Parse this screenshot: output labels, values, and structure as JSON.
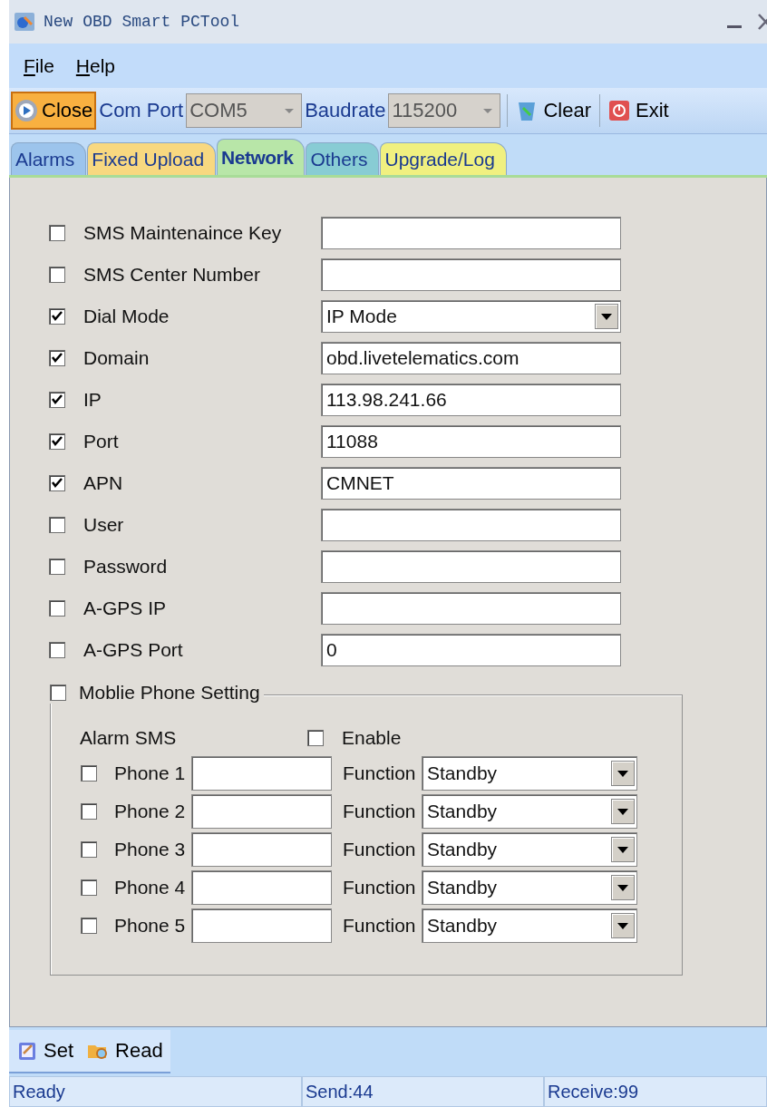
{
  "window": {
    "title": "New OBD Smart PCTool"
  },
  "menu": [
    "File",
    "Help"
  ],
  "toolbar": {
    "close_button": "Close",
    "com_port_label": "Com Port",
    "com_port": "COM5",
    "baudrate_label": "Baudrate",
    "baudrate": "115200",
    "clear_button": "Clear",
    "exit_button": "Exit"
  },
  "tabs": [
    {
      "label": "Alarms",
      "selected": false,
      "color": "#9cc4ec"
    },
    {
      "label": "Fixed Upload",
      "selected": false,
      "color": "#f8d880"
    },
    {
      "label": "Network",
      "selected": true,
      "color": "#b8e6a8"
    },
    {
      "label": "Others",
      "selected": false,
      "color": "#88ccd4"
    },
    {
      "label": "Upgrade/Log",
      "selected": false,
      "color": "#f0f080"
    }
  ],
  "fields": [
    {
      "kind": "text",
      "label": "SMS Maintenaince Key",
      "checked": false
    },
    {
      "kind": "text",
      "label": "SMS Center Number",
      "checked": false
    },
    {
      "kind": "dropdown",
      "label": "Dial Mode",
      "checked": true,
      "value": "IP Mode"
    },
    {
      "kind": "text",
      "label": "Domain",
      "checked": true,
      "value": "obd.livetelematics.com"
    },
    {
      "kind": "text",
      "label": "IP",
      "checked": true,
      "value": "113.98.241.66"
    },
    {
      "kind": "text",
      "label": "Port",
      "checked": true,
      "value": "11088"
    },
    {
      "kind": "text",
      "label": "APN",
      "checked": true,
      "value": "CMNET"
    },
    {
      "kind": "text",
      "label": "User",
      "checked": false
    },
    {
      "kind": "text",
      "label": "Password",
      "checked": false
    },
    {
      "kind": "text",
      "label": "A-GPS IP",
      "checked": false
    },
    {
      "kind": "text",
      "label": "A-GPS Port",
      "checked": false,
      "value": "0"
    }
  ],
  "mobile": {
    "legend": "Moblie Phone Setting",
    "checked": false,
    "alarm_sms": "Alarm SMS",
    "enable": {
      "label": "Enable",
      "checked": false
    },
    "phones": [
      {
        "label": "Phone 1",
        "checked": false,
        "function_label": "Function",
        "function": "Standby"
      },
      {
        "label": "Phone 2",
        "checked": false,
        "function_label": "Function",
        "function": "Standby"
      },
      {
        "label": "Phone 3",
        "checked": false,
        "function_label": "Function",
        "function": "Standby"
      },
      {
        "label": "Phone 4",
        "checked": false,
        "function_label": "Function",
        "function": "Standby"
      },
      {
        "label": "Phone 5",
        "checked": false,
        "function_label": "Function",
        "function": "Standby"
      }
    ]
  },
  "actions": [
    "Set",
    "Read"
  ],
  "status_bar": [
    "Ready",
    "Send:44",
    "Receive:99"
  ]
}
